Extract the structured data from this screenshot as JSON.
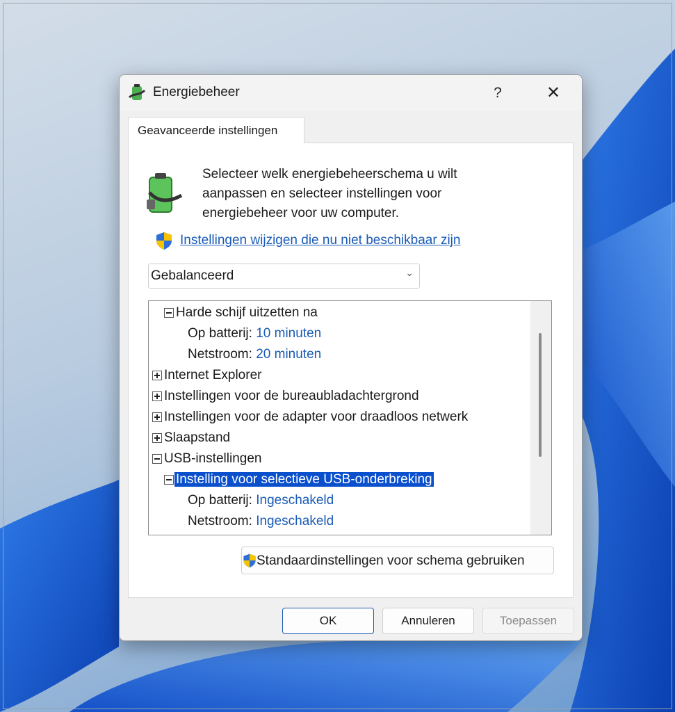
{
  "window": {
    "title": "Energiebeheer",
    "help_label": "?",
    "close_label": "✕"
  },
  "tab": {
    "label": "Geavanceerde instellingen"
  },
  "intro": {
    "line1": "Selecteer welk energiebeheerschema u wilt",
    "line2": "aanpassen en selecteer instellingen voor",
    "line3": "energiebeheer voor uw computer.",
    "link": "Instellingen wijzigen die nu niet beschikbaar zijn"
  },
  "plan_select": {
    "value": "Gebalanceerd",
    "chevron": "⌄"
  },
  "tree": {
    "hdd": {
      "label": "Harde schijf uitzetten na",
      "battery_label": "Op batterij:",
      "battery_value": "10 minuten",
      "ac_label": "Netstroom:",
      "ac_value": "20 minuten"
    },
    "ie": "Internet Explorer",
    "desktop": "Instellingen voor de bureaubladachtergrond",
    "wireless": "Instellingen voor de adapter voor draadloos netwerk",
    "sleep": "Slaapstand",
    "usb": "USB-instellingen",
    "usb_suspend": {
      "label": "Instelling voor selectieve USB-onderbreking",
      "battery_label": "Op batterij:",
      "battery_value": "Ingeschakeld",
      "ac_label": "Netstroom:",
      "ac_value": "Ingeschakeld"
    }
  },
  "buttons": {
    "restore_defaults": "Standaardinstellingen voor schema gebruiken",
    "ok": "OK",
    "cancel": "Annuleren",
    "apply": "Toepassen"
  },
  "icons": {
    "title": "power-options-icon",
    "battery": "battery-plug-icon",
    "shield": "uac-shield-icon"
  },
  "colors": {
    "link": "#1a5bb5",
    "selection": "#0a4fcc",
    "wallpaper_bloom": "#1560d8"
  }
}
